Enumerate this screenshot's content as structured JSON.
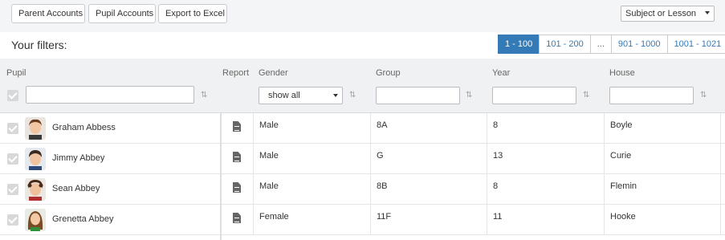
{
  "toolbar": {
    "parent_accounts": "Parent Accounts",
    "pupil_accounts": "Pupil Accounts",
    "export_excel": "Export to Excel",
    "subject_select": "Subject or Lesson"
  },
  "filters": {
    "title": "Your filters:",
    "pages": [
      "1 - 100",
      "101 - 200",
      "...",
      "901 - 1000",
      "1001 - 1021"
    ],
    "active_page": "1 - 100"
  },
  "columns": {
    "pupil": "Pupil",
    "report": "Report",
    "gender": "Gender",
    "group": "Group",
    "year": "Year",
    "house": "House",
    "gender_filter_value": "show all"
  },
  "rows": [
    {
      "name": "Graham Abbess",
      "gender": "Male",
      "group": "8A",
      "year": "8",
      "house": "Boyle",
      "avatar": "boy-brown-hair"
    },
    {
      "name": "Jimmy Abbey",
      "gender": "Male",
      "group": "G",
      "year": "13",
      "house": "Curie",
      "avatar": "boy-dark-hair"
    },
    {
      "name": "Sean Abbey",
      "gender": "Male",
      "group": "8B",
      "year": "8",
      "house": "Flemin",
      "avatar": "boy-curly-hair"
    },
    {
      "name": "Grenetta Abbey",
      "gender": "Female",
      "group": "11F",
      "year": "11",
      "house": "Hooke",
      "avatar": "girl-brown-hair"
    }
  ],
  "colors": {
    "accent": "#337ab7",
    "header_bg": "#f0f1f2",
    "toolbar_bg": "#f4f5f6"
  }
}
